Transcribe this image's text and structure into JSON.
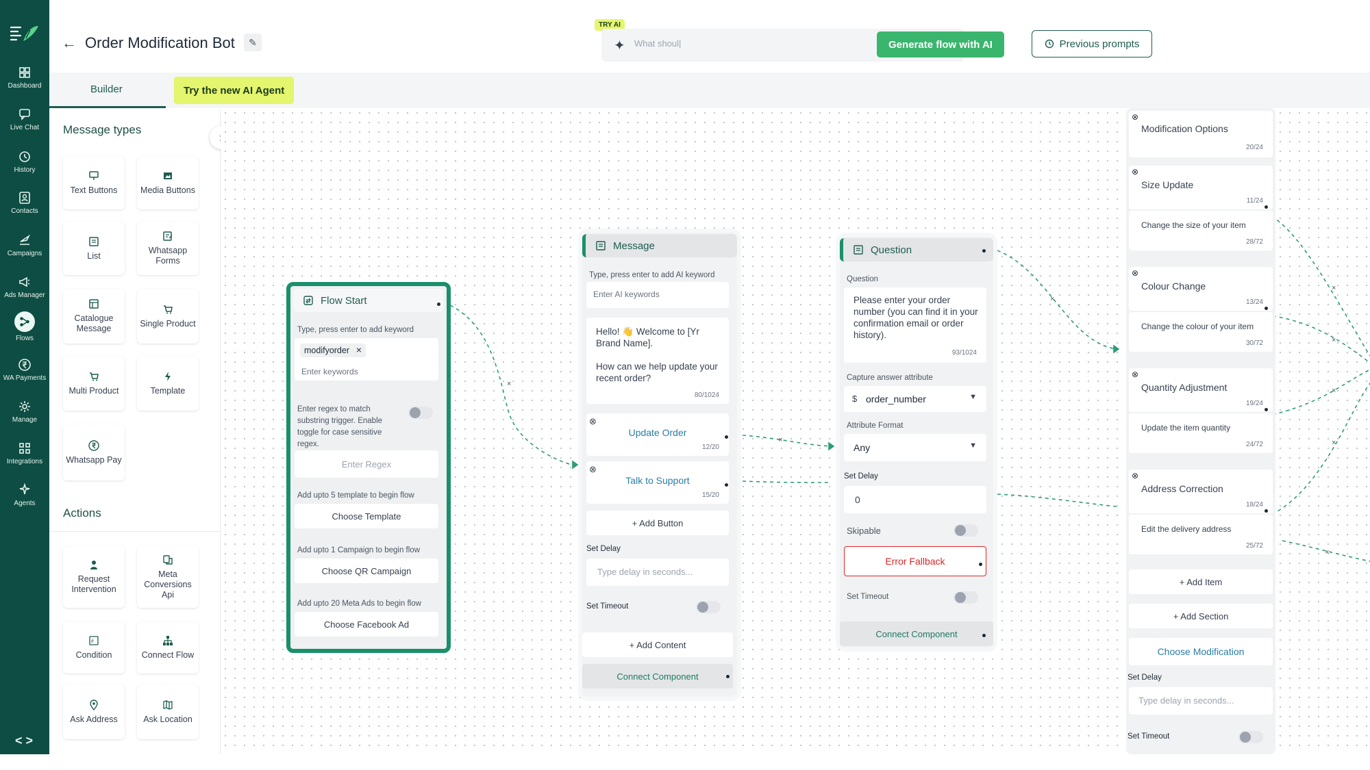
{
  "nav": {
    "items": [
      {
        "label": "Dashboard",
        "icon": "dashboard-icon"
      },
      {
        "label": "Live Chat",
        "icon": "chat-icon"
      },
      {
        "label": "History",
        "icon": "history-icon"
      },
      {
        "label": "Contacts",
        "icon": "contacts-icon"
      },
      {
        "label": "Campaigns",
        "icon": "campaigns-icon"
      },
      {
        "label": "Ads Manager",
        "icon": "megaphone-icon"
      },
      {
        "label": "Flows",
        "icon": "flows-icon"
      },
      {
        "label": "WA Payments",
        "icon": "payments-icon"
      },
      {
        "label": "Manage",
        "icon": "gear-icon"
      },
      {
        "label": "Integrations",
        "icon": "integrations-icon"
      },
      {
        "label": "Agents",
        "icon": "agents-icon"
      }
    ],
    "code_toggle": "< >"
  },
  "header": {
    "title": "Order Modification Bot",
    "try_ai_badge": "TRY AI",
    "ai_input_value": "What shoul|",
    "generate_button": "Generate flow with AI",
    "previous_prompts": "Previous prompts"
  },
  "tabs": {
    "builder": "Builder",
    "ai_agent": "Try the new AI Agent"
  },
  "panel": {
    "message_types_title": "Message types",
    "message_types": [
      {
        "label": "Text Buttons",
        "icon": "text-buttons-icon"
      },
      {
        "label": "Media Buttons",
        "icon": "media-icon"
      },
      {
        "label": "List",
        "icon": "list-icon"
      },
      {
        "label": "Whatsapp Forms",
        "icon": "form-icon"
      },
      {
        "label": "Catalogue Message",
        "icon": "catalogue-icon"
      },
      {
        "label": "Single Product",
        "icon": "cart-icon"
      },
      {
        "label": "Multi Product",
        "icon": "cart-icon"
      },
      {
        "label": "Template",
        "icon": "lightning-icon"
      },
      {
        "label": "Whatsapp Pay",
        "icon": "rupee-icon"
      }
    ],
    "actions_title": "Actions",
    "actions": [
      {
        "label": "Request Intervention",
        "icon": "person-icon"
      },
      {
        "label": "Meta Conversions Api",
        "icon": "meta-icon"
      },
      {
        "label": "Condition",
        "icon": "condition-icon"
      },
      {
        "label": "Connect Flow",
        "icon": "hierarchy-icon"
      },
      {
        "label": "Ask Address",
        "icon": "pin-icon"
      },
      {
        "label": "Ask Location",
        "icon": "map-icon"
      }
    ]
  },
  "flow_start": {
    "title": "Flow Start",
    "keyword_label": "Type, press enter to add keyword",
    "keyword_chip": "modifyorder",
    "keyword_placeholder": "Enter keywords",
    "regex_text": "Enter regex to match substring trigger. Enable toggle for case sensitive regex.",
    "regex_placeholder": "Enter Regex",
    "template_label": "Add upto 5 template to begin flow",
    "template_button": "Choose Template",
    "campaign_label": "Add upto 1 Campaign to begin flow",
    "campaign_button": "Choose QR Campaign",
    "ads_label": "Add upto 20 Meta Ads to begin flow",
    "ads_button": "Choose Facebook Ad"
  },
  "message_node": {
    "title": "Message",
    "ai_label": "Type, press enter to add AI keyword",
    "ai_placeholder": "Enter AI keywords",
    "body": "Hello! 👋 Welcome to [Yr Brand Name].\n\nHow can we help update your recent order?",
    "body_count": "80/1024",
    "buttons": [
      {
        "label": "Update Order",
        "count": "12/20"
      },
      {
        "label": "Talk to Support",
        "count": "15/20"
      }
    ],
    "add_button": "+ Add Button",
    "set_delay": "Set Delay",
    "delay_placeholder": "Type delay in seconds...",
    "set_timeout": "Set Timeout",
    "add_content": "+ Add Content",
    "connect": "Connect Component"
  },
  "question_node": {
    "title": "Question",
    "question_label": "Question",
    "question_text": "Please enter your order number (you can find it in your confirmation email or order history).",
    "question_count": "93/1024",
    "capture_label": "Capture answer attribute",
    "capture_value": "order_number",
    "format_label": "Attribute Format",
    "format_value": "Any",
    "delay_label": "Set Delay",
    "delay_value": "0",
    "skipable": "Skipable",
    "error_fallback": "Error Fallback",
    "timeout": "Set Timeout",
    "connect": "Connect Component"
  },
  "list_node": {
    "header": {
      "title": "Modification Options",
      "count": "20/24"
    },
    "sections": [
      {
        "title": "Size Update",
        "title_count": "11/24",
        "desc": "Change the size of your item",
        "desc_count": "28/72"
      },
      {
        "title": "Colour Change",
        "title_count": "13/24",
        "desc": "Change the colour of your item",
        "desc_count": "30/72"
      },
      {
        "title": "Quantity Adjustment",
        "title_count": "19/24",
        "desc": "Update the item quantity",
        "desc_count": "24/72"
      },
      {
        "title": "Address Correction",
        "title_count": "18/24",
        "desc": "Edit the delivery address",
        "desc_count": "25/72"
      }
    ],
    "add_item": "+ Add Item",
    "add_section": "+ Add Section",
    "choose": "Choose Modification",
    "set_delay": "Set Delay",
    "delay_placeholder": "Type delay in seconds...",
    "set_timeout": "Set Timeout"
  },
  "colors": {
    "sidebar": "#0e4d43",
    "accent": "#1a8f6b",
    "primary_button": "#3ab56d",
    "highlight": "#e4f56e",
    "error": "#dc2626"
  }
}
